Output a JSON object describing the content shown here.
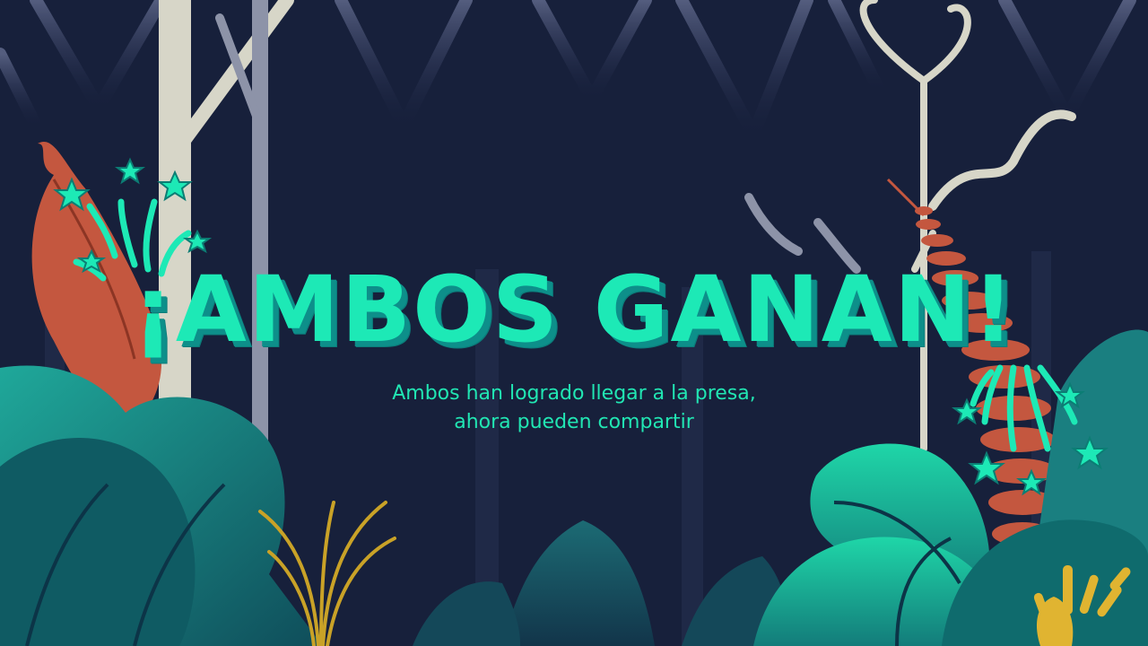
{
  "screen": {
    "title": "¡AMBOS GANAN!",
    "subtitle_line1": "Ambos han logrado llegar a la presa,",
    "subtitle_line2": "ahora pueden compartir"
  },
  "colors": {
    "background": "#17203b",
    "accent": "#1de9b6",
    "title_shadow": "#0d8f8a",
    "plant_red": "#c4573f",
    "leaf_teal": "#1a8a86",
    "grass_gold": "#c9a227"
  },
  "decor": {
    "left_fireworks_icon": "star-burst-icon",
    "right_fireworks_icon": "star-burst-icon"
  }
}
